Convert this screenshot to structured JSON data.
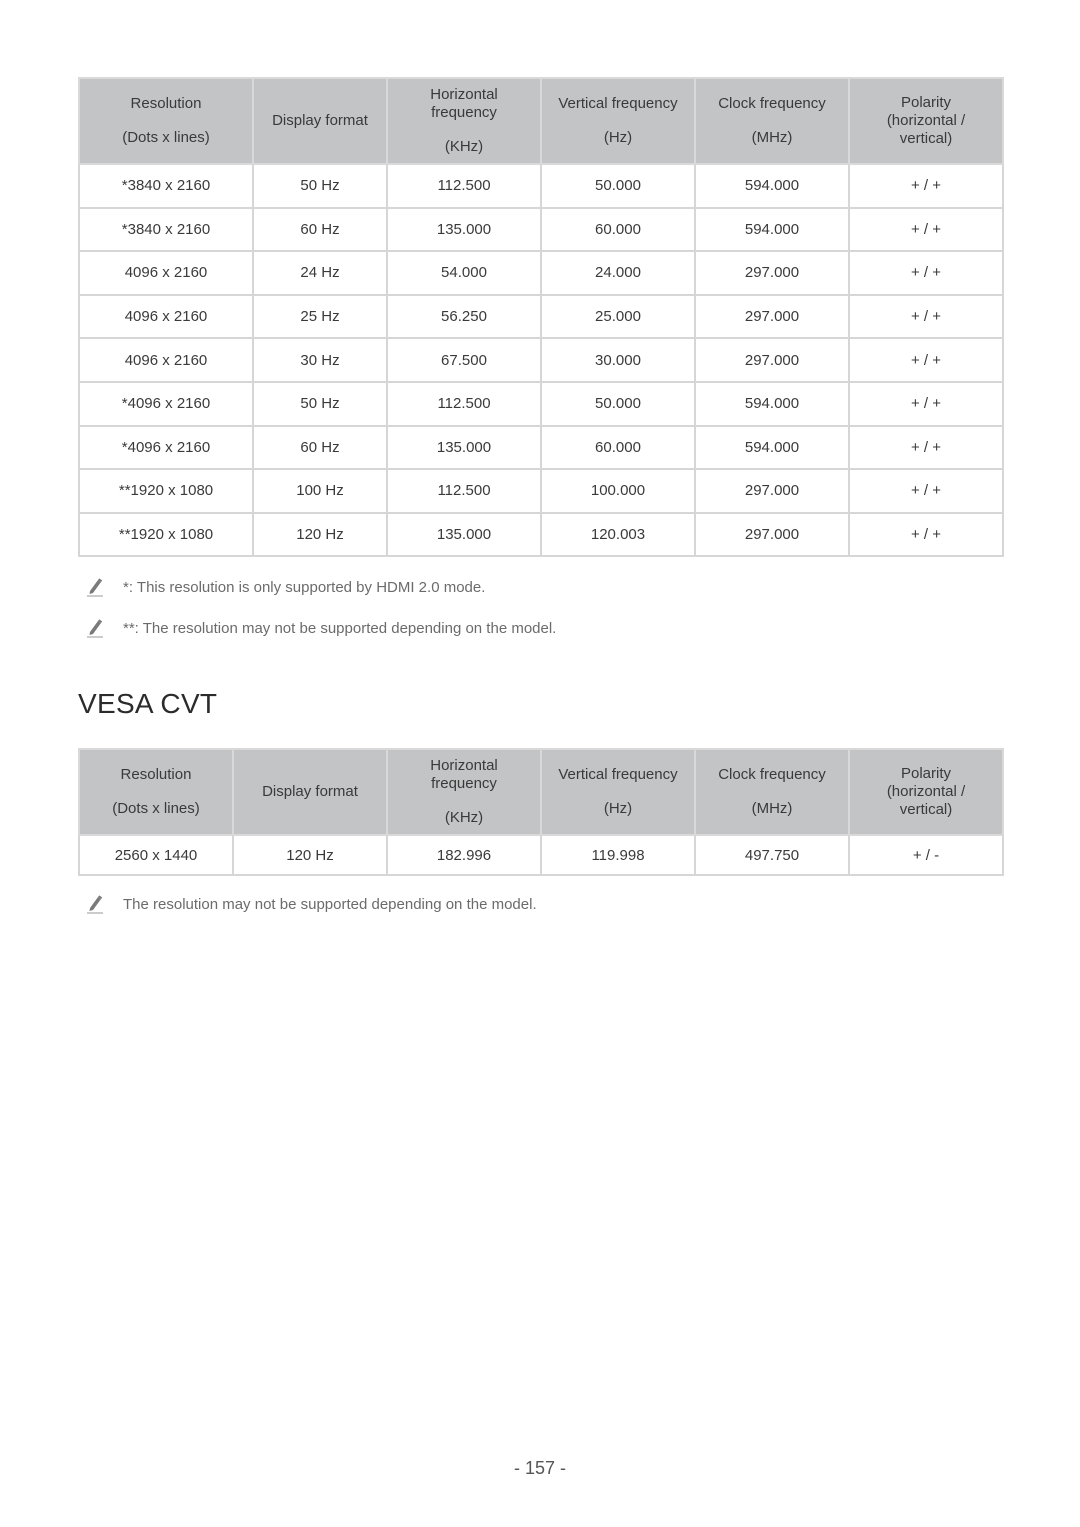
{
  "table1": {
    "headers": {
      "resolution": "Resolution",
      "resolution_unit": "(Dots x lines)",
      "display_format": "Display format",
      "hfreq": "Horizontal frequency",
      "hfreq_unit": "(KHz)",
      "vfreq": "Vertical frequency",
      "vfreq_unit": "(Hz)",
      "clock": "Clock frequency",
      "clock_unit": "(MHz)",
      "polarity": "Polarity (horizontal / vertical)"
    },
    "rows": [
      [
        "*3840 x 2160",
        "50 Hz",
        "112.500",
        "50.000",
        "594.000",
        "+ / +"
      ],
      [
        "*3840 x 2160",
        "60 Hz",
        "135.000",
        "60.000",
        "594.000",
        "+ / +"
      ],
      [
        "4096 x 2160",
        "24 Hz",
        "54.000",
        "24.000",
        "297.000",
        "+ / +"
      ],
      [
        "4096 x 2160",
        "25 Hz",
        "56.250",
        "25.000",
        "297.000",
        "+ / +"
      ],
      [
        "4096 x 2160",
        "30 Hz",
        "67.500",
        "30.000",
        "297.000",
        "+ / +"
      ],
      [
        "*4096 x 2160",
        "50 Hz",
        "112.500",
        "50.000",
        "594.000",
        "+ / +"
      ],
      [
        "*4096 x 2160",
        "60 Hz",
        "135.000",
        "60.000",
        "594.000",
        "+ / +"
      ],
      [
        "**1920 x 1080",
        "100 Hz",
        "112.500",
        "100.000",
        "297.000",
        "+ / +"
      ],
      [
        "**1920 x 1080",
        "120 Hz",
        "135.000",
        "120.003",
        "297.000",
        "+ / +"
      ]
    ]
  },
  "notes1": [
    "*: This resolution is only supported by HDMI 2.0 mode.",
    "**: The resolution may not be supported depending on the model."
  ],
  "section_title": "VESA CVT",
  "table2": {
    "headers": {
      "resolution": "Resolution",
      "resolution_unit": "(Dots x lines)",
      "display_format": "Display format",
      "hfreq": "Horizontal frequency",
      "hfreq_unit": "(KHz)",
      "vfreq": "Vertical frequency",
      "vfreq_unit": "(Hz)",
      "clock": "Clock frequency",
      "clock_unit": "(MHz)",
      "polarity": "Polarity (horizontal / vertical)"
    },
    "rows": [
      [
        "2560 x 1440",
        "120 Hz",
        "182.996",
        "119.998",
        "497.750",
        "+ / -"
      ]
    ]
  },
  "notes2": [
    "The resolution may not be supported depending on the model."
  ],
  "page_number": "- 157 -",
  "colors": {
    "header_bg": "#c3c4c5",
    "border": "#d6d6d6",
    "note_text": "#6b6b6b"
  }
}
